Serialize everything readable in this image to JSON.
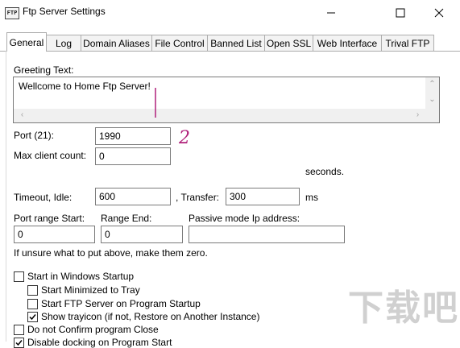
{
  "window": {
    "icon_text": "FTP",
    "title": "Ftp Server Settings",
    "minimize_glyph": "—",
    "maximize_glyph": "☐",
    "close_glyph": "✕"
  },
  "tabs": [
    {
      "label": "General",
      "active": true
    },
    {
      "label": "Log"
    },
    {
      "label": "Domain Aliases"
    },
    {
      "label": "File Control"
    },
    {
      "label": "Banned List"
    },
    {
      "label": "Open SSL"
    },
    {
      "label": "Web Interface"
    },
    {
      "label": "Trival FTP"
    }
  ],
  "greeting": {
    "label": "Greeting Text:",
    "value": "Wellcome to Home Ftp Server!"
  },
  "port": {
    "label": "Port (21):",
    "value": "1990"
  },
  "max_clients": {
    "label": "Max client count:",
    "value": "0"
  },
  "seconds_label": "seconds.",
  "timeout": {
    "idle_label": "Timeout, Idle:",
    "idle_value": "600",
    "transfer_label": ", Transfer:",
    "transfer_value": "300",
    "unit": "ms"
  },
  "port_range": {
    "start_label": "Port range Start:",
    "start_value": "0",
    "end_label": "Range End:",
    "end_value": "0",
    "passive_label": "Passive mode Ip address:",
    "passive_value": ""
  },
  "hint": "If unsure what to put above, make them zero.",
  "options": [
    {
      "label": "Start in Windows Startup",
      "checked": false
    },
    {
      "label": "Start Minimized to Tray",
      "checked": false
    },
    {
      "label": "Start FTP Server on Program Startup",
      "checked": false
    },
    {
      "label": "Show trayicon (if not, Restore on Another Instance)",
      "checked": true
    },
    {
      "label": "Do not Confirm program Close",
      "checked": false
    },
    {
      "label": "Disable docking on Program Start",
      "checked": true
    }
  ],
  "annotation": {
    "text": "2",
    "color": "#b0207a"
  },
  "watermark": {
    "text": "下载吧"
  }
}
